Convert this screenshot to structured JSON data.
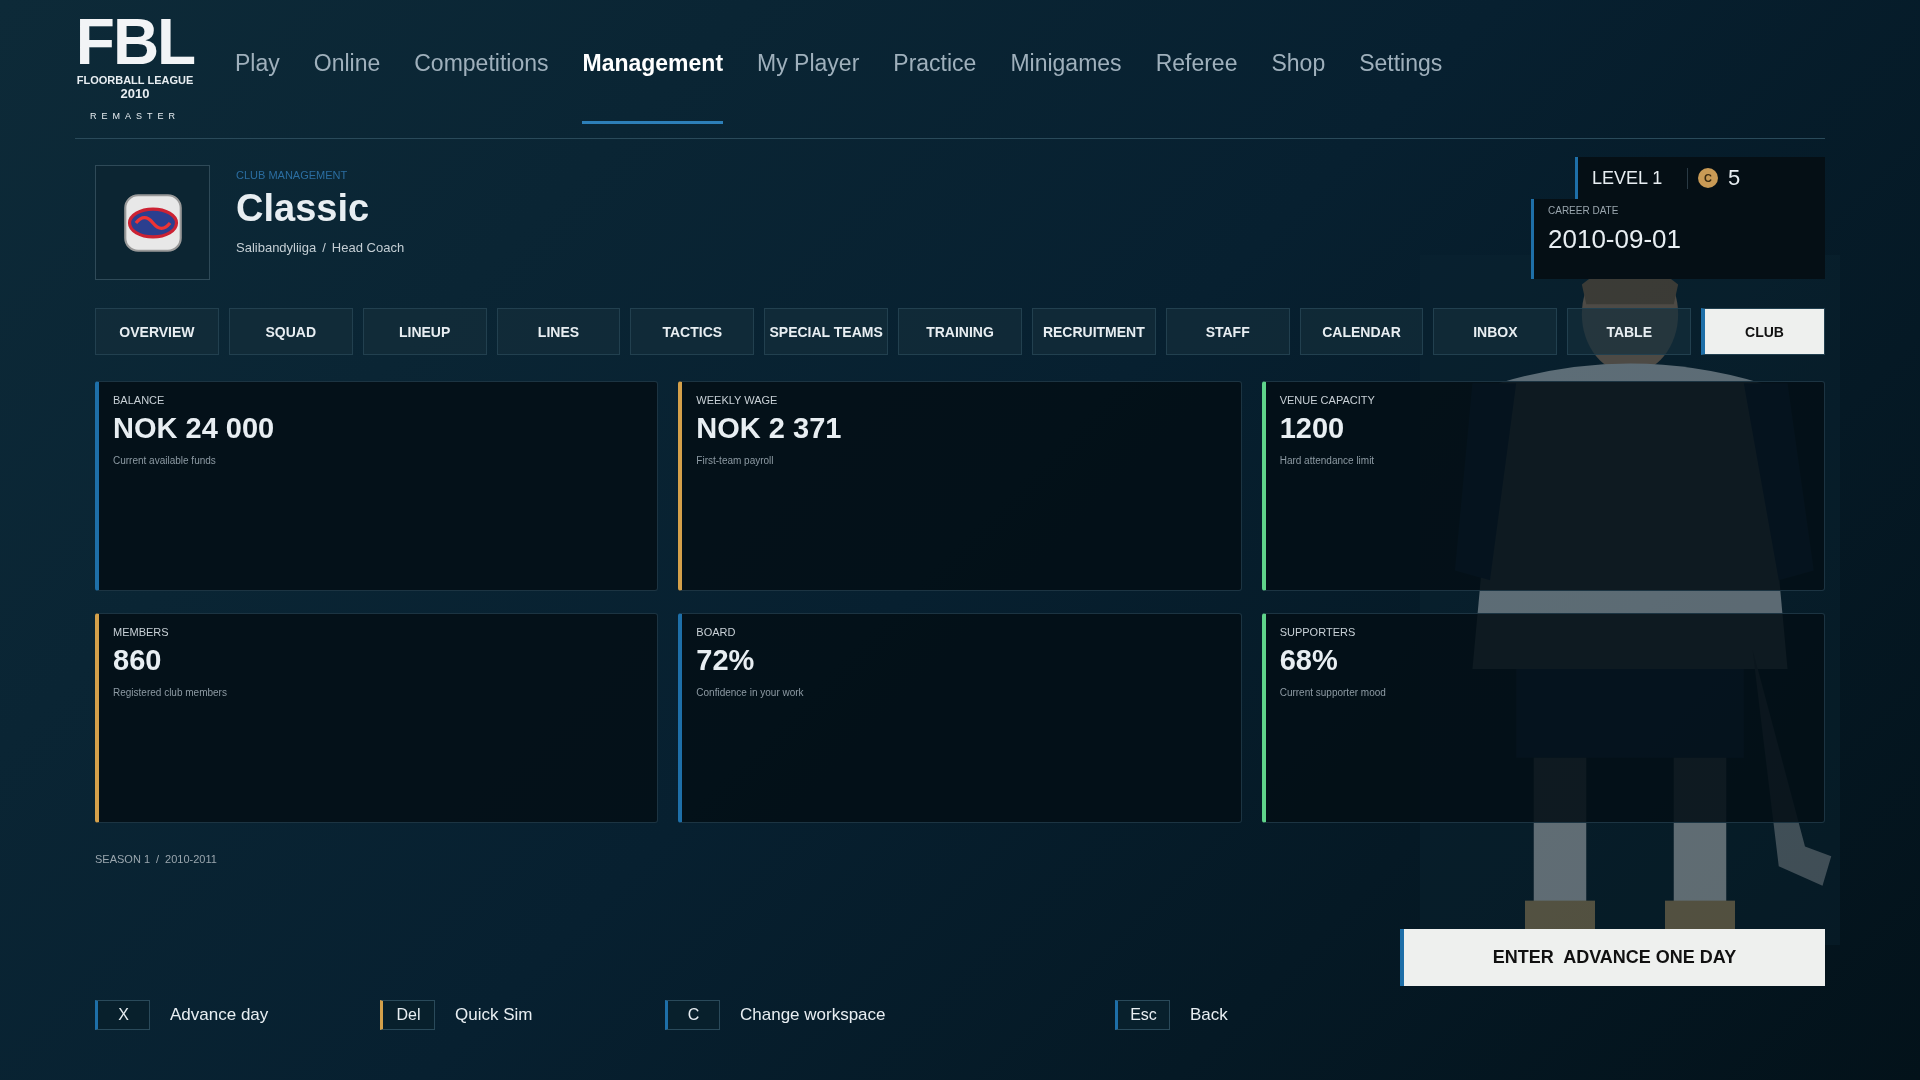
{
  "logo": {
    "title": "FBL",
    "subtitle": "FLOORBALL LEAGUE",
    "year": "2010",
    "tagline": "REMASTER"
  },
  "nav": [
    {
      "label": "Play",
      "selected": false
    },
    {
      "label": "Online",
      "selected": false
    },
    {
      "label": "Competitions",
      "selected": false
    },
    {
      "label": "Management",
      "selected": true
    },
    {
      "label": "My Player",
      "selected": false
    },
    {
      "label": "Practice",
      "selected": false
    },
    {
      "label": "Minigames",
      "selected": false
    },
    {
      "label": "Referee",
      "selected": false
    },
    {
      "label": "Shop",
      "selected": false
    },
    {
      "label": "Settings",
      "selected": false
    }
  ],
  "club": {
    "eyebrow": "CLUB MANAGEMENT",
    "name": "Classic",
    "league": "Salibandyliiga",
    "separator": "/",
    "role": "Head Coach"
  },
  "level": {
    "label": "LEVEL 1",
    "coin": "C",
    "coins": "5"
  },
  "career_date": {
    "label": "CAREER DATE",
    "value": "2010-09-01"
  },
  "tabs": [
    {
      "label": "OVERVIEW",
      "selected": false
    },
    {
      "label": "SQUAD",
      "selected": false
    },
    {
      "label": "LINEUP",
      "selected": false
    },
    {
      "label": "LINES",
      "selected": false
    },
    {
      "label": "TACTICS",
      "selected": false
    },
    {
      "label": "SPECIAL TEAMS",
      "selected": false
    },
    {
      "label": "TRAINING",
      "selected": false
    },
    {
      "label": "RECRUITMENT",
      "selected": false
    },
    {
      "label": "STAFF",
      "selected": false
    },
    {
      "label": "CALENDAR",
      "selected": false
    },
    {
      "label": "INBOX",
      "selected": false
    },
    {
      "label": "TABLE",
      "selected": false
    },
    {
      "label": "CLUB",
      "selected": true
    }
  ],
  "cards": [
    {
      "label": "BALANCE",
      "value": "NOK 24 000",
      "note": "Current available funds",
      "color": "#1e6fa8"
    },
    {
      "label": "WEEKLY WAGE",
      "value": "NOK 2 371",
      "note": "First-team payroll",
      "color": "#d4a04a"
    },
    {
      "label": "VENUE CAPACITY",
      "value": "1200",
      "note": "Hard attendance limit",
      "color": "#5fd38a"
    },
    {
      "label": "MEMBERS",
      "value": "860",
      "note": "Registered club members",
      "color": "#d4a04a"
    },
    {
      "label": "BOARD",
      "value": "72%",
      "note": "Confidence in your work",
      "color": "#1e6fa8"
    },
    {
      "label": "SUPPORTERS",
      "value": "68%",
      "note": "Current supporter mood",
      "color": "#5fd38a"
    }
  ],
  "season": {
    "label": "SEASON 1",
    "separator": "/",
    "years": "2010-2011"
  },
  "advance_button": {
    "label": "ENTER  ADVANCE ONE DAY"
  },
  "hints": [
    {
      "key": "X",
      "label": "Advance day",
      "color": "#1e6fa8"
    },
    {
      "key": "Del",
      "label": "Quick Sim",
      "color": "#d4a04a"
    },
    {
      "key": "C",
      "label": "Change workspace",
      "color": "#1e6fa8"
    },
    {
      "key": "Esc",
      "label": "Back",
      "color": "#1e6fa8"
    }
  ]
}
